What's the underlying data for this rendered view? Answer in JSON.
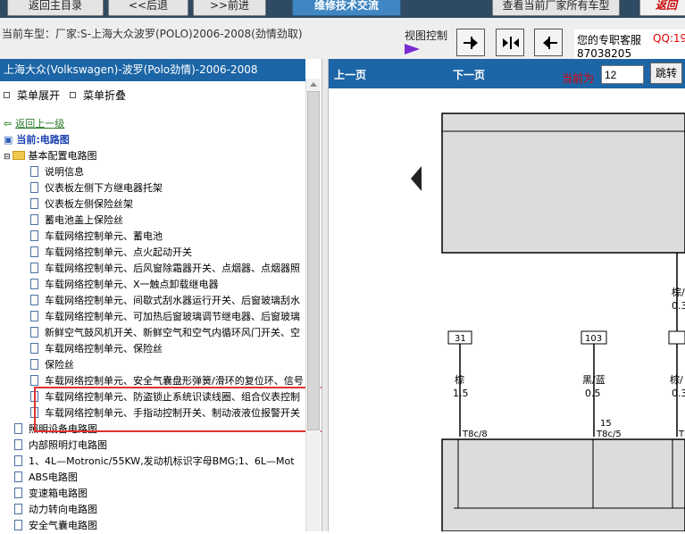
{
  "topbar": {
    "home": "返回主目录",
    "back": "<<后退",
    "forward": ">>前进",
    "forum": "维修技术交流",
    "all_models": "查看当前厂家所有车型",
    "red_btn": "返回"
  },
  "model_bar": {
    "current_model": "当前车型：厂家:S-上海大众波罗(POLO)2006-2008(劲情劲取)",
    "view_control": "视图控制",
    "service_label": "您的专职客服",
    "service_qq": "QQ:19",
    "service_number": "87038205"
  },
  "left_panel": {
    "header": "上海大众(Volkswagen)-波罗(Polo劲情)-2006-2008",
    "expand": "菜单展开",
    "collapse": "菜单折叠",
    "back_link": "返回上一级",
    "current": "当前:电路图",
    "folder": "基本配置电路图",
    "items": [
      "说明信息",
      "仪表板左侧下方继电器托架",
      "仪表板左侧保险丝架",
      "蓄电池盖上保险丝",
      "车载网络控制单元、蓄电池",
      "车载网络控制单元、点火起动开关",
      "车载网络控制单元、后风窗除霜器开关、点烟器、点烟器照",
      "车载网络控制单元、X一触点卸载继电器",
      "车载网络控制单元、间歇式刮水器运行开关、后窗玻璃刮水",
      "车载网络控制单元、可加热后窗玻璃调节继电器、后窗玻璃",
      "新鲜空气鼓风机开关、新鲜空气和空气内循环风门开关、空",
      "车载网络控制单元、保险丝",
      "保险丝",
      "车载网络控制单元、安全气囊盘形弹簧/滑环的复位环、信号",
      "车载网络控制单元、防盗锁止系统识读线圈、组合仪表控制",
      "车载网络控制单元、手指动控制开关、制动液液位报警开关"
    ],
    "top_level": [
      "照明设备电路图",
      "内部照明灯电路图",
      "1、4L—Motronic/55KW,发动机标识字母BMG;1、6L—Mot",
      "ABS电路图",
      "变速箱电路图",
      "动力转向电路图",
      "安全气囊电路图"
    ]
  },
  "right_panel": {
    "prev": "上一页",
    "next": "下一页",
    "current_label": "当前为",
    "page_value": "12",
    "jump": "跳转"
  },
  "diagram": {
    "connector_a": "31",
    "connector_b": "103",
    "wire_a_color": "棕",
    "wire_a_size": "1.5",
    "wire_b_color": "黑/蓝",
    "wire_b_size": "0.5",
    "wire_c_color": "棕/",
    "wire_c_size": "0.3",
    "wire_d_color": "棕/",
    "wire_d_size": "0.3",
    "pin_a": "T8c/8",
    "pin_b": "15",
    "pin_c": "T8c/5",
    "pin_d": "T8c"
  }
}
